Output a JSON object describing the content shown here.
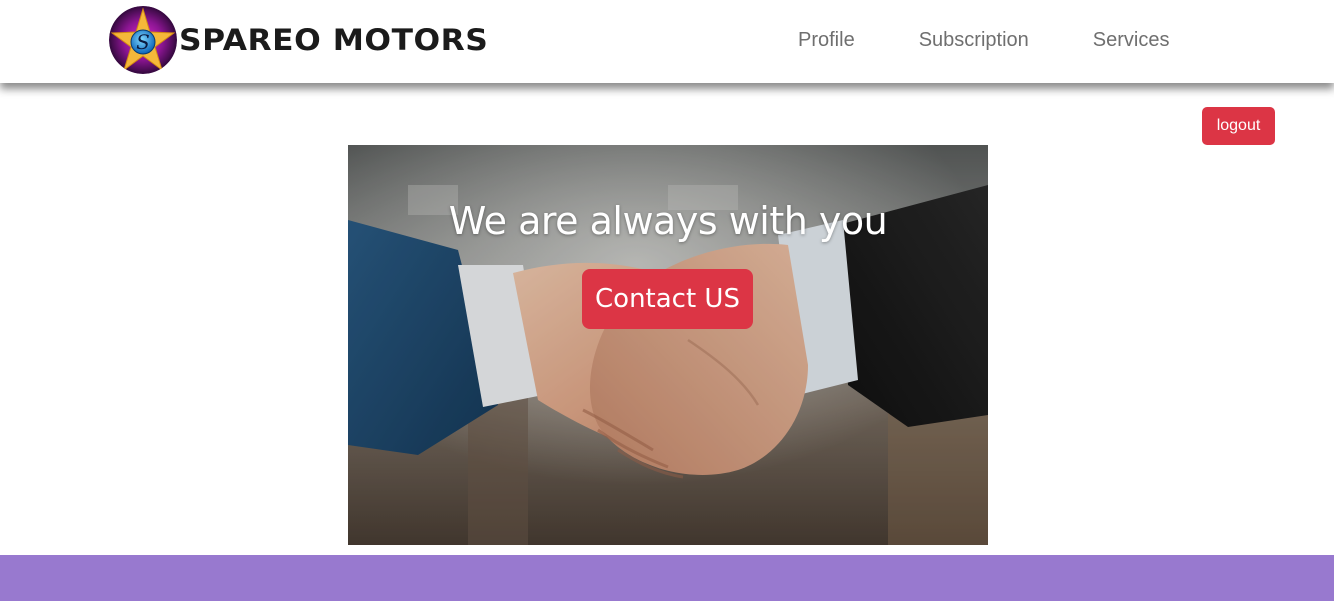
{
  "brand": {
    "name": "SPAREO MOTORS",
    "logo_letter": "S",
    "logo_icon": "star-logo-icon"
  },
  "nav": {
    "items": [
      {
        "label": "Profile"
      },
      {
        "label": "Subscription"
      },
      {
        "label": "Services"
      }
    ]
  },
  "actions": {
    "logout_label": "logout"
  },
  "hero": {
    "title": "We are always with you",
    "cta_label": "Contact US",
    "image": "handshake-photo"
  },
  "colors": {
    "accent_red": "#dc3545",
    "footer_purple": "#9879cf",
    "nav_text": "#6f6f6f",
    "brand_text": "#1b1b1b"
  }
}
